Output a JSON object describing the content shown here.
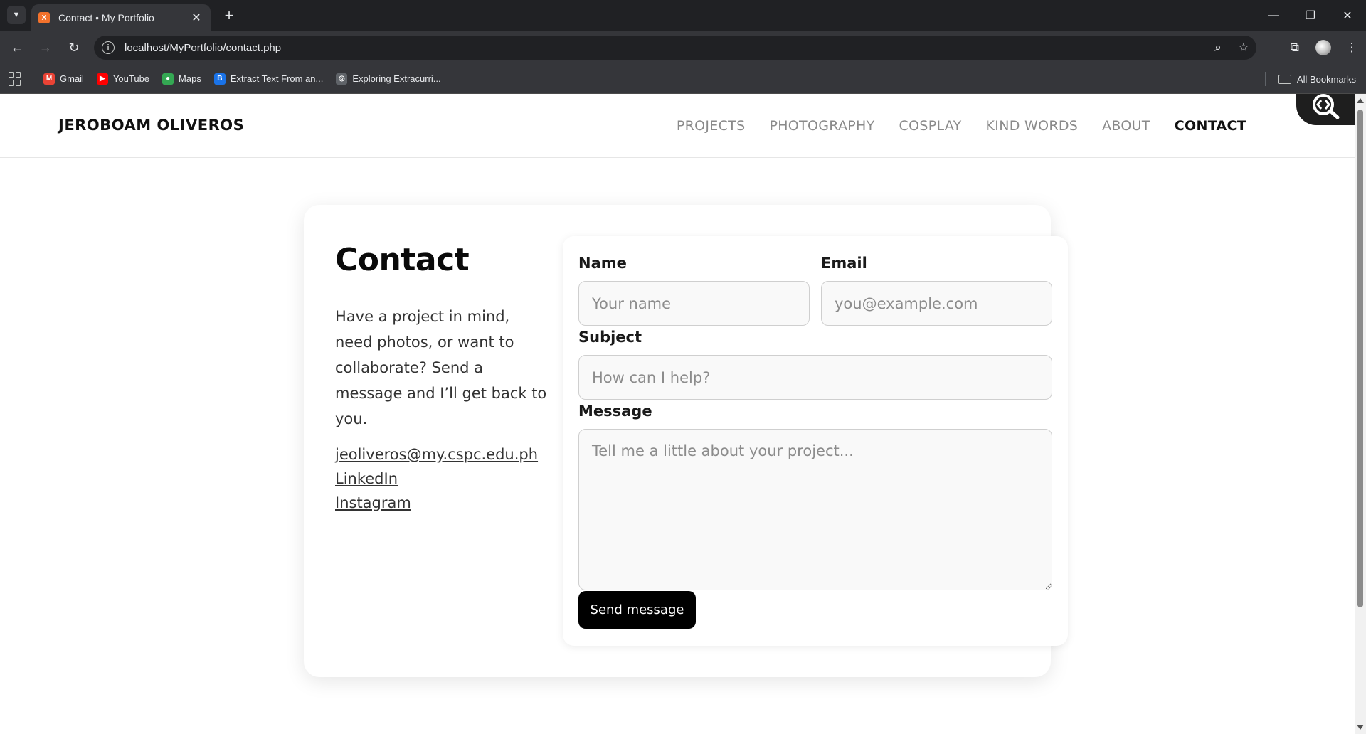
{
  "browser": {
    "tab_title": "Contact • My Portfolio",
    "favicon_letter": "X",
    "url": "localhost/MyPortfolio/contact.php",
    "bookmarks": [
      {
        "label": "Gmail",
        "icon": "gmail-icon",
        "color": "#ea4335",
        "glyph": "M"
      },
      {
        "label": "YouTube",
        "icon": "youtube-icon",
        "color": "#ff0000",
        "glyph": "▶"
      },
      {
        "label": "Maps",
        "icon": "maps-icon",
        "color": "#34a853",
        "glyph": "●"
      },
      {
        "label": "Extract Text From an...",
        "icon": "bookmark-b-icon",
        "color": "#1a73e8",
        "glyph": "B"
      },
      {
        "label": "Exploring Extracurri...",
        "icon": "globe-icon",
        "color": "#5f6368",
        "glyph": "◎"
      }
    ],
    "all_bookmarks": "All Bookmarks"
  },
  "site": {
    "brand": "JEROBOAM OLIVEROS",
    "nav": [
      "PROJECTS",
      "PHOTOGRAPHY",
      "COSPLAY",
      "KIND WORDS",
      "ABOUT",
      "CONTACT"
    ],
    "active_nav": "CONTACT"
  },
  "contact": {
    "title": "Contact",
    "intro": "Have a project in mind, need photos, or want to collaborate? Send a message and I’ll get back to you.",
    "email": "jeoliveros@my.cspc.edu.ph",
    "linkedin": "LinkedIn",
    "instagram": "Instagram"
  },
  "form": {
    "name_label": "Name",
    "name_placeholder": "Your name",
    "email_label": "Email",
    "email_placeholder": "you@example.com",
    "subject_label": "Subject",
    "subject_placeholder": "How can I help?",
    "message_label": "Message",
    "message_placeholder": "Tell me a little about your project...",
    "submit_label": "Send message"
  }
}
